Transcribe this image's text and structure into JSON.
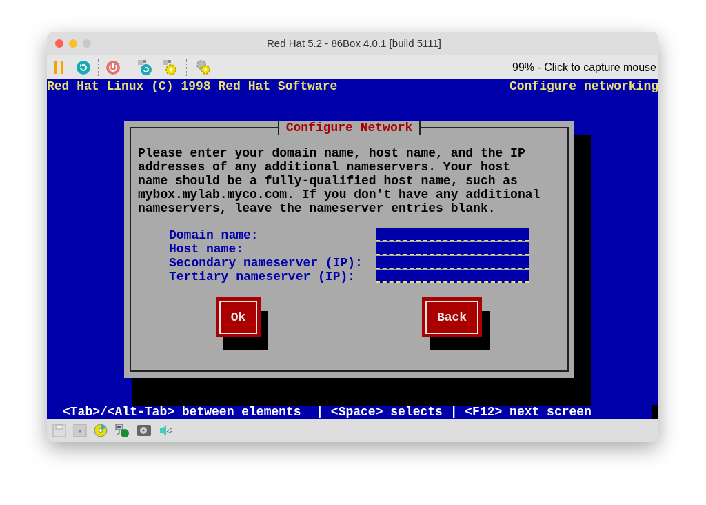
{
  "window": {
    "title": "Red Hat 5.2 - 86Box 4.0.1 [build 5111]"
  },
  "toolbar": {
    "status": "99% - Click to capture mouse"
  },
  "screen": {
    "header_left": "Red Hat Linux (C) 1998 Red Hat Software",
    "header_right": "Configure networking",
    "dialog": {
      "title": "Configure Network",
      "text": "Please enter your domain name, host name, and the IP addresses of any additional nameservers. Your host name should be a fully-qualified host name, such as mybox.mylab.myco.com. If you don't have any additional nameservers, leave the nameserver entries blank.",
      "fields": [
        {
          "label": "Domain name:"
        },
        {
          "label": "Host name:"
        },
        {
          "label": "Secondary nameserver (IP):"
        },
        {
          "label": "Tertiary nameserver (IP):"
        }
      ],
      "buttons": [
        "Ok",
        "Back"
      ]
    },
    "help_line": "<Tab>/<Alt-Tab> between elements  | <Space> selects | <F12> next screen"
  }
}
